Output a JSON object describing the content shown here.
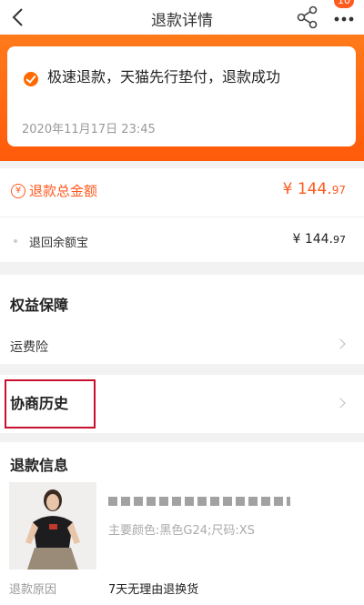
{
  "nav": {
    "title": "退款详情",
    "badge": "10",
    "back_icon": "chevron-left-icon",
    "share_icon": "share-icon",
    "more_icon": "more-icon"
  },
  "status": {
    "message": "极速退款，天猫先行垫付，退款成功",
    "time": "2020年11月17日 23:45",
    "accent": "#ff6a00"
  },
  "refund_total": {
    "label": "退款总金额",
    "amount_int": "¥ 144.",
    "amount_dec": "97",
    "color": "#ff5a1f"
  },
  "balance": {
    "label": "退回余额宝",
    "amount_int": "¥ 144.",
    "amount_dec": "97"
  },
  "rights": {
    "heading": "权益保障",
    "items": [
      {
        "label": "运费险"
      }
    ]
  },
  "history": {
    "label": "协商历史",
    "highlight_color": "#c8102e"
  },
  "refund_info": {
    "heading": "退款信息",
    "product_spec": "主要颜色:黑色G24;尺码:XS",
    "reason_label": "退款原因",
    "reason": "7天无理由退换货"
  }
}
